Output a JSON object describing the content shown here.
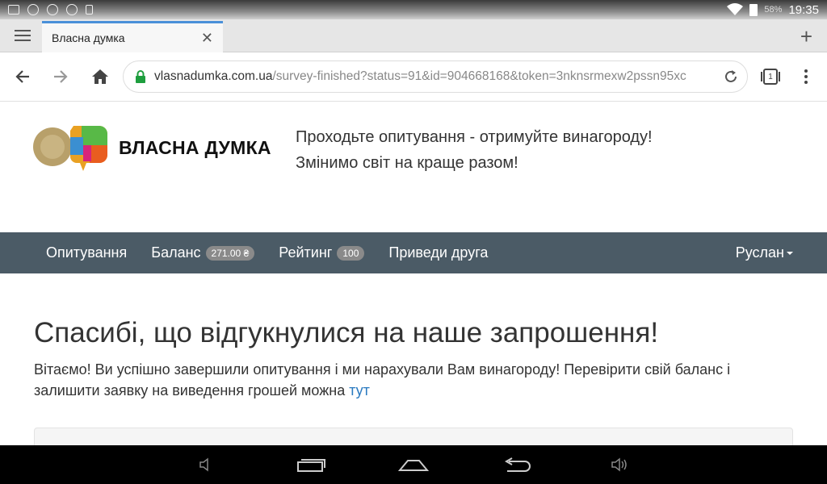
{
  "status_bar": {
    "time": "19:35",
    "battery": "58%"
  },
  "tab": {
    "title": "Власна думка"
  },
  "url": {
    "host": "vlasnadumka.com.ua",
    "path": "/survey-finished?status=91&id=904668168&token=3nknsrmexw2pssn95xc"
  },
  "tab_count": "1",
  "site": {
    "logo_text": "ВЛАСНА ДУМКА",
    "slogan_line1": "Проходьте опитування - отримуйте винагороду!",
    "slogan_line2": "Змінимо світ на краще разом!"
  },
  "nav": {
    "surveys": "Опитування",
    "balance": "Баланс",
    "balance_value": "271.00 ₴",
    "rating": "Рейтинг",
    "rating_value": "100",
    "invite": "Приведи друга",
    "user": "Руслан"
  },
  "main": {
    "heading": "Спасибі, що відгукнулися на наше запрошення!",
    "text": "Вітаємо! Ви успішно завершили опитування і ми нарахували Вам винагороду! Перевірити свій баланс і залишити заявку на виведення грошей можна ",
    "link": "тут"
  },
  "colors": {
    "navbar": "#4b5b66",
    "link": "#2a7ac0",
    "tab_accent": "#4a90d9"
  }
}
